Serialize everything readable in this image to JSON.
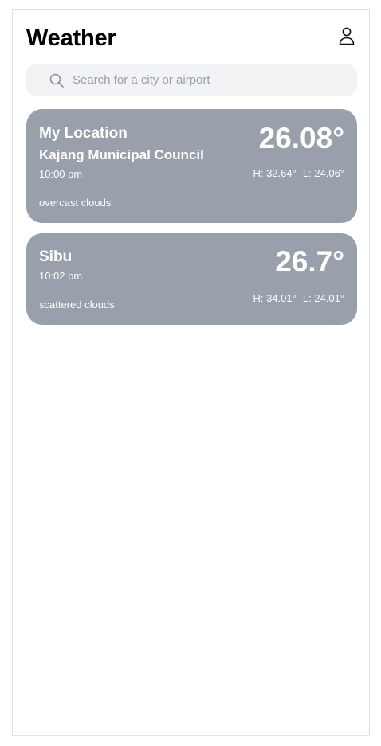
{
  "header": {
    "title": "Weather",
    "profile_icon": "user-icon"
  },
  "search": {
    "placeholder": "Search for a city or airport",
    "value": "",
    "icon": "search-icon"
  },
  "locations": [
    {
      "name": "My Location",
      "subtitle": "Kajang Municipal Council",
      "time": "10:00 pm",
      "description": "overcast clouds",
      "temperature": "26.08°",
      "high": "H: 32.64°",
      "low": "L: 24.06°"
    },
    {
      "name": "Sibu",
      "time": "10:02 pm",
      "description": "scattered clouds",
      "temperature": "26.7°",
      "high": "H: 34.01°",
      "low": "L: 24.01°"
    }
  ],
  "colors": {
    "card_background": "#9aa0ab",
    "search_background": "#f1f3f5",
    "text_on_card": "#ffffff"
  }
}
